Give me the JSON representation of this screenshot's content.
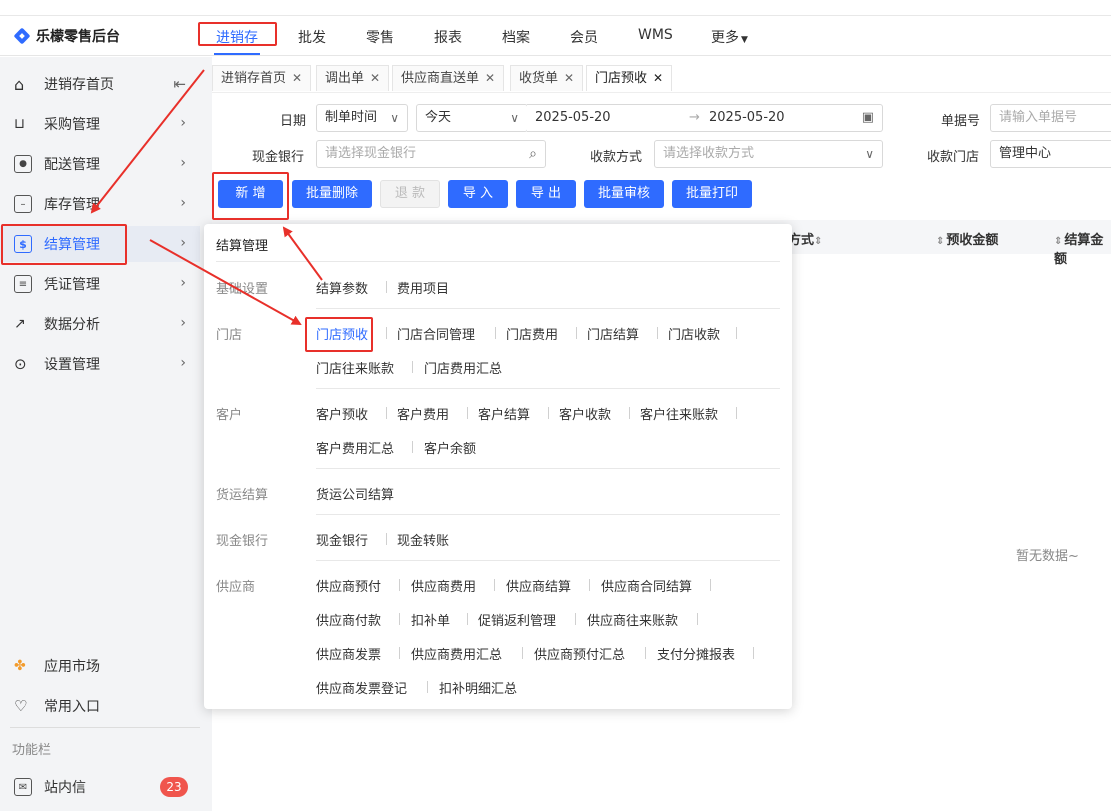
{
  "header": {
    "app_title": "乐檬零售后台",
    "nav": [
      "进销存",
      "批发",
      "零售",
      "报表",
      "档案",
      "会员",
      "WMS",
      "更多"
    ]
  },
  "sidebar": {
    "items": [
      {
        "label": "进销存首页",
        "icon": "home-icon"
      },
      {
        "label": "采购管理",
        "icon": "cart-icon"
      },
      {
        "label": "配送管理",
        "icon": "delivery-icon"
      },
      {
        "label": "库存管理",
        "icon": "inventory-icon"
      },
      {
        "label": "结算管理",
        "icon": "dollar-icon"
      },
      {
        "label": "凭证管理",
        "icon": "document-icon"
      },
      {
        "label": "数据分析",
        "icon": "chart-icon"
      },
      {
        "label": "设置管理",
        "icon": "gear-icon"
      }
    ],
    "active_index": 4,
    "bottom": [
      {
        "label": "应用市场",
        "icon": "app-market-icon"
      },
      {
        "label": "常用入口",
        "icon": "heart-icon"
      }
    ],
    "caption": "功能栏",
    "inbox": {
      "label": "站内信",
      "badge": "23"
    }
  },
  "tabs": [
    {
      "label": "进销存首页",
      "active": false
    },
    {
      "label": "调出单",
      "active": false
    },
    {
      "label": "供应商直送单",
      "active": false
    },
    {
      "label": "收货单",
      "active": false
    },
    {
      "label": "门店预收",
      "active": true
    }
  ],
  "filters": {
    "date_label": "日期",
    "date_type": "制单时间",
    "date_range": "今天",
    "date_start": "2025-05-20",
    "date_end": "2025-05-20",
    "doc_no_label": "单据号",
    "doc_no_placeholder": "请输入单据号",
    "bank_label": "现金银行",
    "bank_placeholder": "请选择现金银行",
    "pay_method_label": "收款方式",
    "pay_method_placeholder": "请选择收款方式",
    "store_label": "收款门店",
    "store_value": "管理中心"
  },
  "buttons": [
    "新 增",
    "批量删除",
    "退 款",
    "导 入",
    "导 出",
    "批量审核",
    "批量打印"
  ],
  "table": {
    "headers": [
      "方式",
      "预收金额",
      "结算金额"
    ],
    "empty_text": "暂无数据~"
  },
  "popup": {
    "title": "结算管理",
    "groups": [
      {
        "name": "基础设置",
        "rows": [
          [
            "结算参数",
            "费用项目"
          ]
        ]
      },
      {
        "name": "门店",
        "rows": [
          [
            "门店预收",
            "门店合同管理",
            "门店费用",
            "门店结算",
            "门店收款"
          ],
          [
            "门店往来账款",
            "门店费用汇总"
          ]
        ]
      },
      {
        "name": "客户",
        "rows": [
          [
            "客户预收",
            "客户费用",
            "客户结算",
            "客户收款",
            "客户往来账款"
          ],
          [
            "客户费用汇总",
            "客户余额"
          ]
        ]
      },
      {
        "name": "货运结算",
        "rows": [
          [
            "货运公司结算"
          ]
        ]
      },
      {
        "name": "现金银行",
        "rows": [
          [
            "现金银行",
            "现金转账"
          ]
        ]
      },
      {
        "name": "供应商",
        "rows": [
          [
            "供应商预付",
            "供应商费用",
            "供应商结算",
            "供应商合同结算"
          ],
          [
            "供应商付款",
            "扣补单",
            "促销返利管理",
            "供应商往来账款"
          ],
          [
            "供应商发票",
            "供应商费用汇总",
            "供应商预付汇总",
            "支付分摊报表"
          ],
          [
            "供应商发票登记",
            "扣补明细汇总"
          ]
        ]
      }
    ],
    "selected": "门店预收"
  },
  "colors": {
    "accent": "#2f6bff",
    "annotation": "#e8302a",
    "badge": "#f0554d"
  }
}
